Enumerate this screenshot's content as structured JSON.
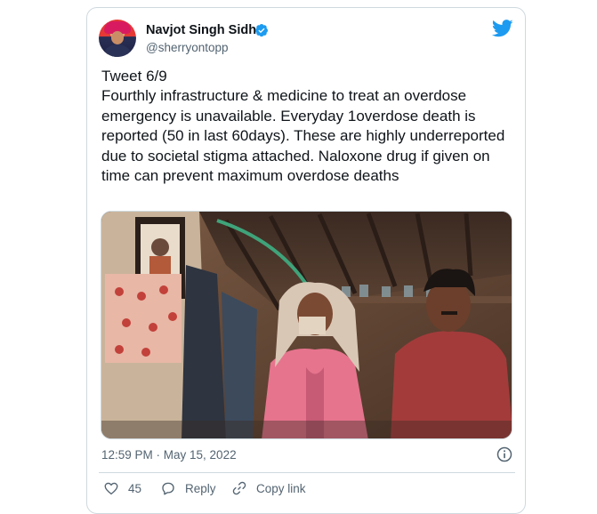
{
  "tweet": {
    "author": {
      "name": "Navjot Singh Sidhu",
      "handle": "@sherryontopp",
      "verified": true
    },
    "text": "Tweet 6/9\nFourthly infrastructure & medicine to treat an overdose emergency is unavailable. Everyday 1overdose death is reported (50 in last 60days). These are highly underreported due to societal stigma attached. Naloxone drug if given on time can prevent maximum overdose deaths",
    "timestamp": "12:59 PM · May 15, 2022",
    "actions": {
      "likes_count": "45",
      "reply_label": "Reply",
      "copy_link_label": "Copy link"
    }
  },
  "icons": {
    "brand": "twitter-bird-icon",
    "verified": "verified-badge-icon",
    "info": "info-icon",
    "like": "heart-icon",
    "reply": "reply-icon",
    "copy": "link-icon"
  },
  "colors": {
    "twitter_blue": "#1d9bf0",
    "secondary_text": "#536471",
    "border": "#cfd9de"
  }
}
